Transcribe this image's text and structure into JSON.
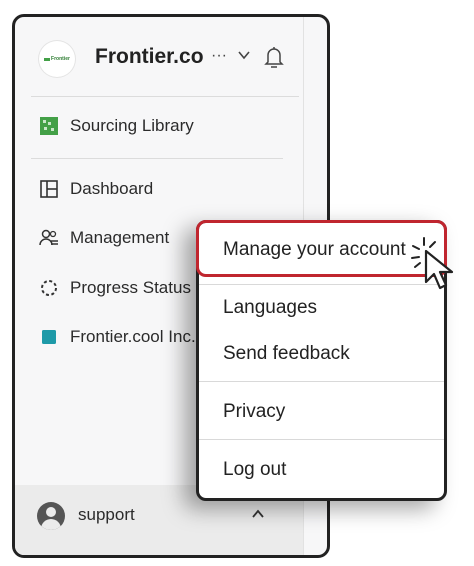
{
  "sidebar": {
    "org": {
      "logo_text": "Frontier",
      "name": "Frontier.co",
      "ellipsis": "···"
    },
    "items": [
      {
        "label": "Sourcing Library",
        "icon": "sourcing-library-icon"
      },
      {
        "label": "Dashboard",
        "icon": "dashboard-icon"
      },
      {
        "label": "Management",
        "icon": "management-icon"
      },
      {
        "label": "Progress Status",
        "icon": "progress-status-icon"
      },
      {
        "label": "Frontier.cool Inc.",
        "icon": "teal-square-icon"
      }
    ],
    "user": {
      "name": "support"
    }
  },
  "menu": {
    "items": [
      "Manage your account",
      "Languages",
      "Send feedback",
      "Privacy",
      "Log out"
    ],
    "highlighted": "Manage your account"
  },
  "colors": {
    "highlight": "#c0262f",
    "sourcing_green": "#43a047",
    "org_teal": "#1e9aa8"
  }
}
